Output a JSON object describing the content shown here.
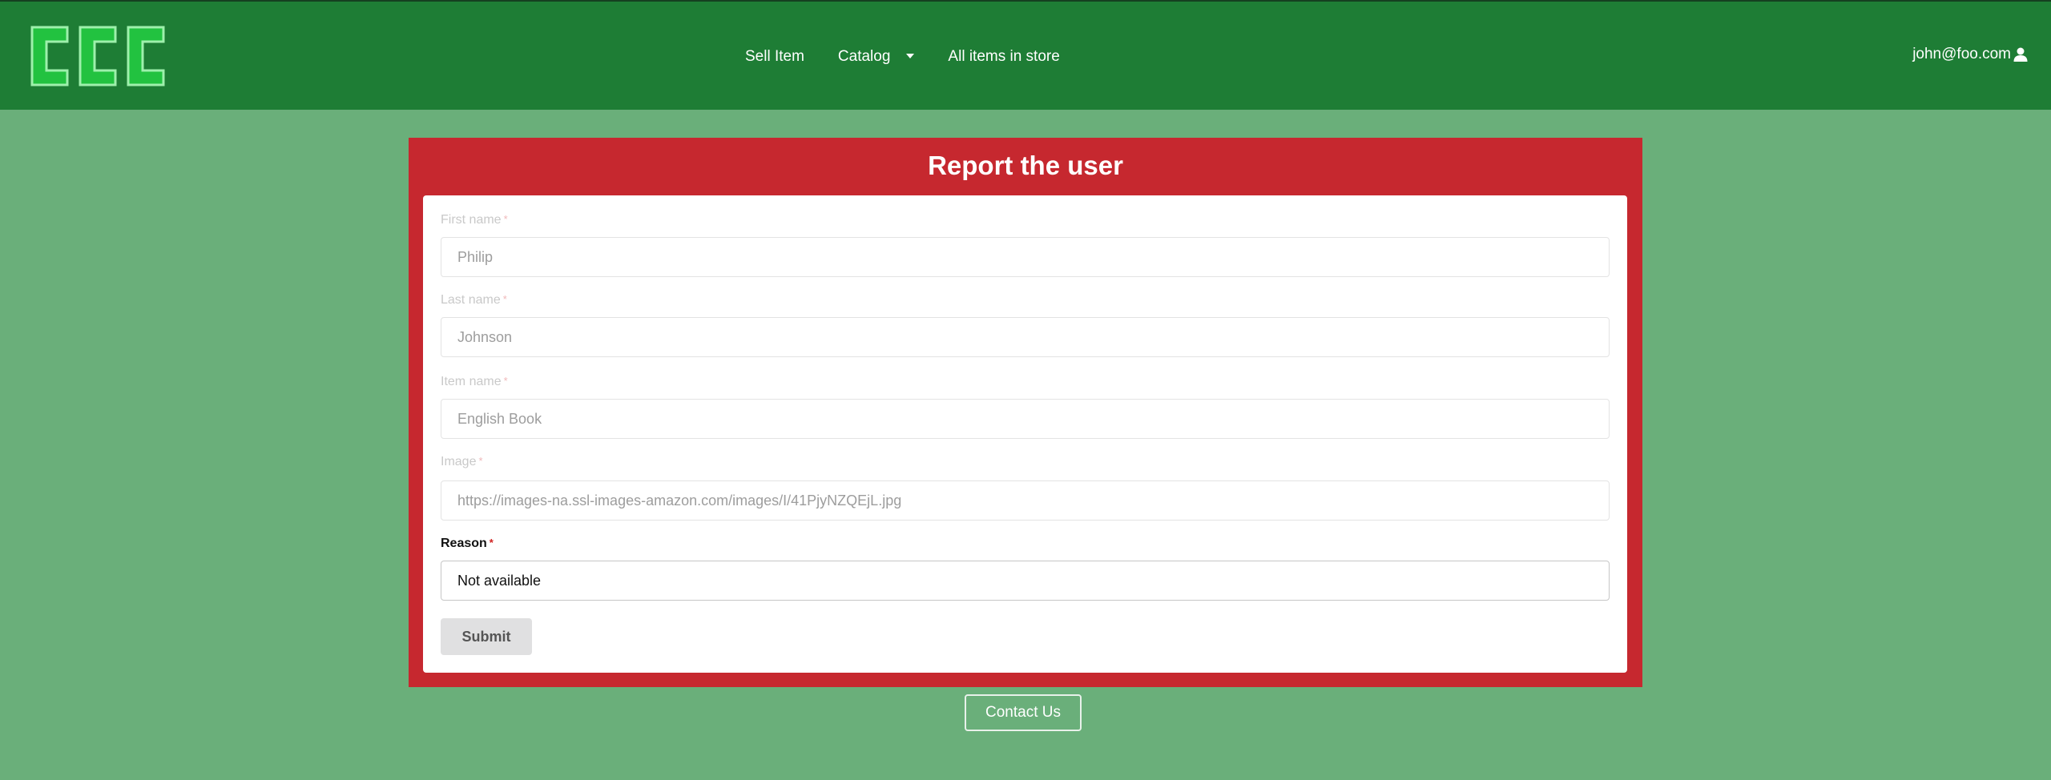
{
  "brand": {
    "logo_text": "CCC",
    "logo_fill": "#22c240",
    "logo_stroke": "#9ef0ac"
  },
  "nav": {
    "sell_item": "Sell Item",
    "catalog": "Catalog",
    "all_items": "All items in store"
  },
  "user": {
    "email": "john@foo.com",
    "icon": "user-icon"
  },
  "form": {
    "title": "Report the user",
    "first_name_label": "First name",
    "first_name_value": "Philip",
    "last_name_label": "Last name",
    "last_name_value": "Johnson",
    "item_name_label": "Item name",
    "item_name_value": "English Book",
    "image_label": "Image",
    "image_value": "https://images-na.ssl-images-amazon.com/images/I/41PjyNZQEjL.jpg",
    "reason_label": "Reason",
    "reason_value": "Not available",
    "required_mark": "*",
    "submit_label": "Submit"
  },
  "footer": {
    "contact_label": "Contact Us"
  },
  "colors": {
    "navbar": "#1e7d35",
    "background": "#6aaf7a",
    "card": "#c6282f",
    "required": "#d0201f"
  }
}
